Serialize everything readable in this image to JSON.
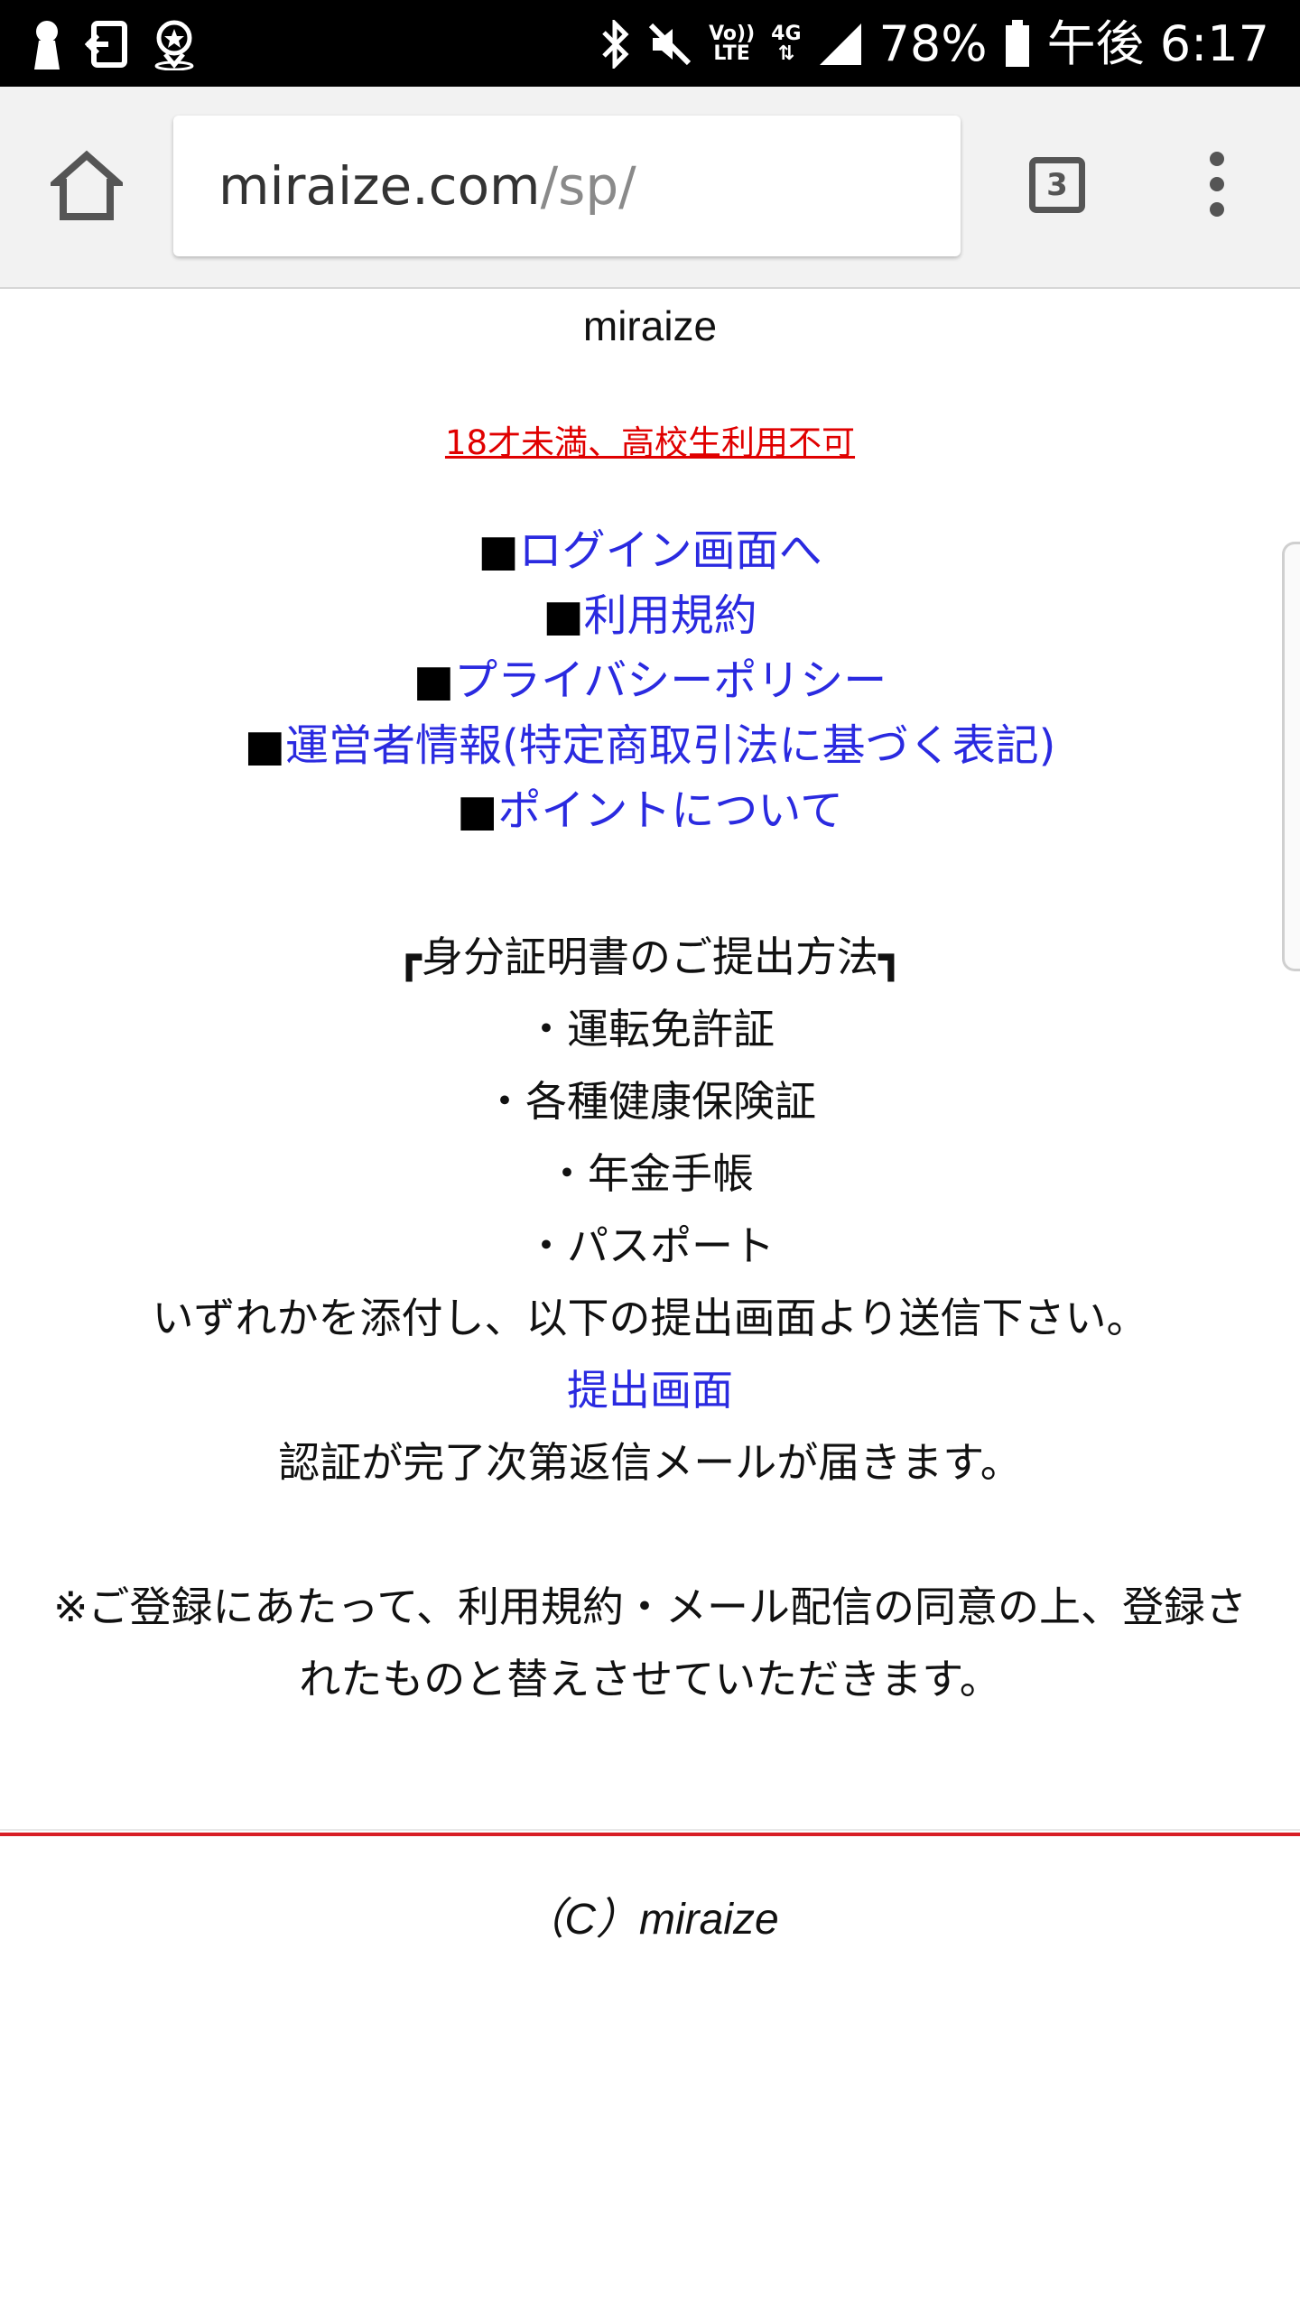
{
  "status_bar": {
    "icons_left": [
      "keyhole-icon",
      "exit-app-icon",
      "location-badge-icon"
    ],
    "icons_right": [
      "bluetooth-icon",
      "mute-icon",
      "volte-icon",
      "4g-icon",
      "signal-icon",
      "battery-icon"
    ],
    "volte_top": "Vo))",
    "volte_bottom": "LTE",
    "net_label": "4G",
    "battery_percent": "78%",
    "time": "午後 6:17"
  },
  "browser": {
    "url_host": "miraize.com",
    "url_path": "/sp/",
    "tab_count": "3"
  },
  "page": {
    "site_title": "miraize",
    "age_notice": "18才未満、高校生利用不可",
    "nav": [
      {
        "bullet": "■",
        "label": "ログイン画面へ"
      },
      {
        "bullet": "■",
        "label": "利用規約"
      },
      {
        "bullet": "■",
        "label": "プライバシーポリシー"
      },
      {
        "bullet": "■",
        "label": "運営者情報(特定商取引法に基づく表記)"
      },
      {
        "bullet": "■",
        "label": "ポイントについて"
      }
    ],
    "id_section": {
      "heading": "┏身分証明書のご提出方法┓",
      "items": [
        "・運転免許証",
        "・各種健康保険証",
        "・年金手帳",
        "・パスポート"
      ],
      "instruction": "いずれかを添付し、以下の提出画面より送信下さい。",
      "submit_link": "提出画面",
      "after": "認証が完了次第返信メールが届きます。"
    },
    "note_line1": "※ご登録にあたって、利用規約・メール配信の同意の上、登録さ",
    "note_line2": "れたものと替えさせていただきます。",
    "copyright": "（C）miraize"
  },
  "colors": {
    "link": "#2a2ae0",
    "warning": "#e00000",
    "divider": "#d81f26"
  }
}
